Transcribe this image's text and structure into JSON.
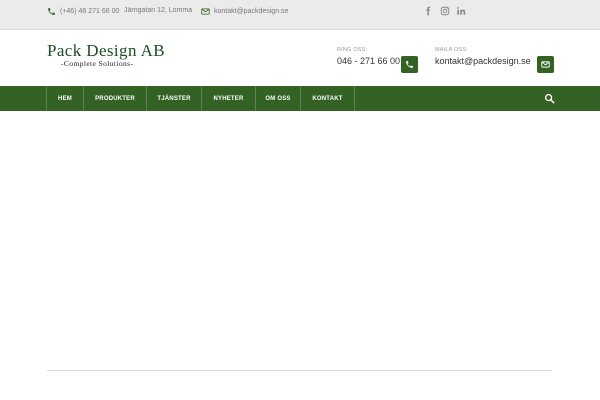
{
  "topbar": {
    "phone": "(+46) 46 271 66 00",
    "address": "Järngatan 12, Lomma",
    "email": "kontakt@packdesign.se",
    "social": [
      "facebook-icon",
      "instagram-icon",
      "linkedin-icon"
    ]
  },
  "logo": {
    "title": "Pack Design AB",
    "tagline": "-Complete Solutions-"
  },
  "contacts": {
    "call_label": "RING OSS:",
    "call_value": "046 - 271 66 00",
    "mail_label": "MAILA OSS:",
    "mail_value": "kontakt@packdesign.se"
  },
  "nav": {
    "items": [
      "HEM",
      "PRODUKTER",
      "TJÄNSTER",
      "NYHETER",
      "OM OSS",
      "KONTAKT"
    ]
  },
  "colors": {
    "brand_green": "#346124",
    "logo_green": "#1d4d25",
    "topbar_bg": "#ebebeb"
  }
}
